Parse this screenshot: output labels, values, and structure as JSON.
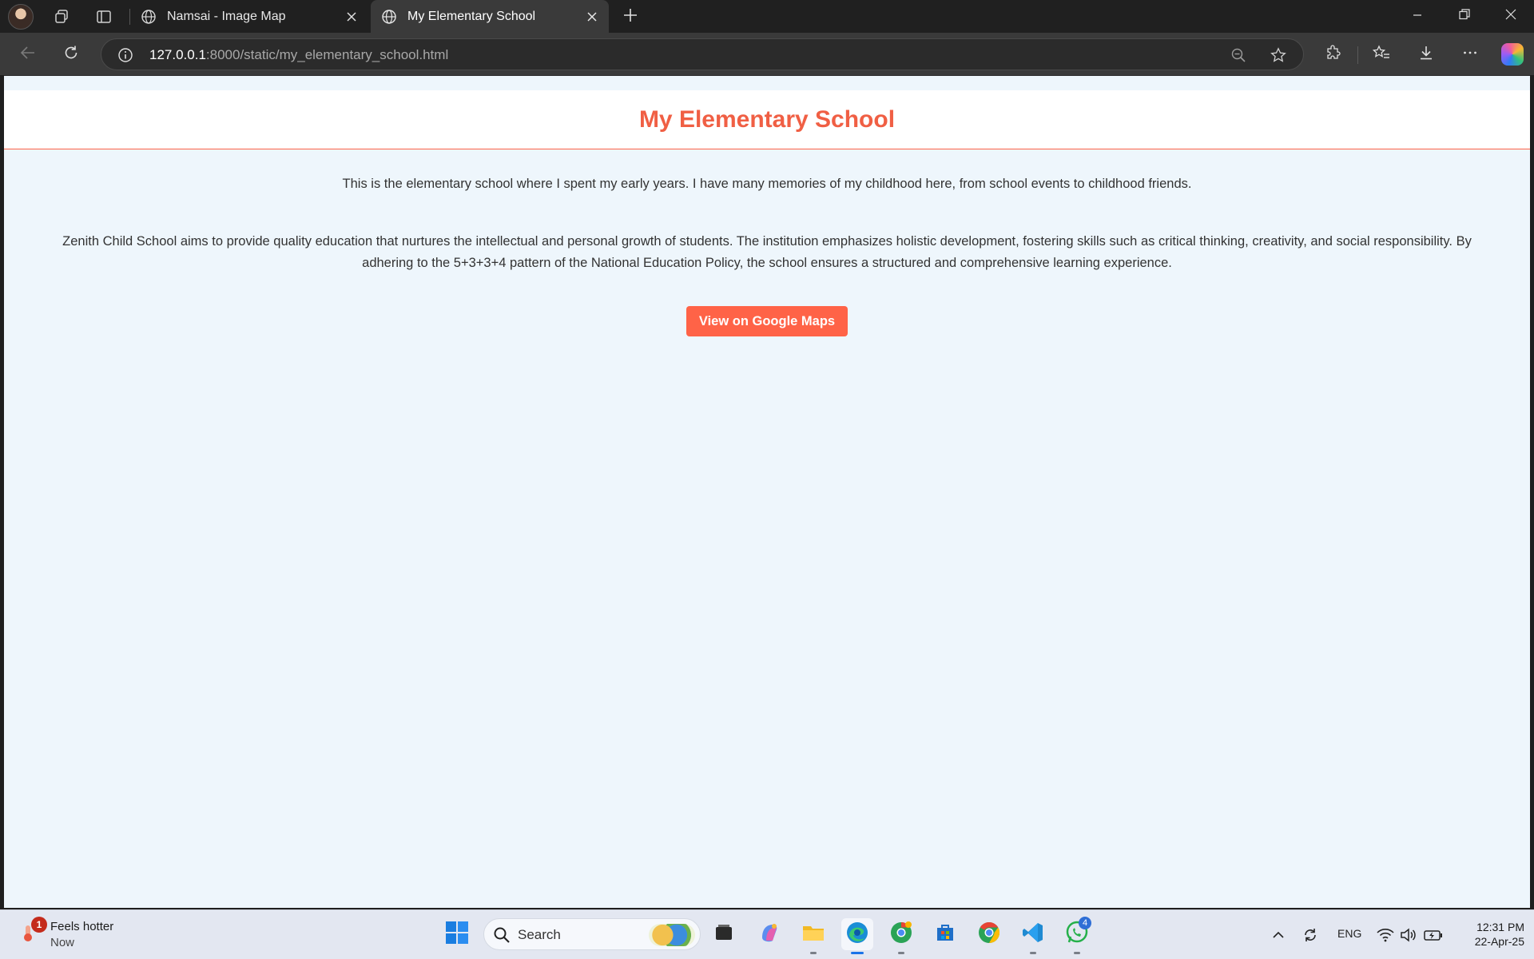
{
  "browser": {
    "tabs": [
      {
        "title": "Namsai - Image Map",
        "active": false
      },
      {
        "title": "My Elementary School",
        "active": true
      }
    ],
    "address": {
      "host": "127.0.0.1",
      "rest": ":8000/static/my_elementary_school.html"
    },
    "icons": [
      "profile-avatar",
      "workspaces-icon",
      "tab-actions-icon",
      "globe-icon",
      "close-icon",
      "plus-icon",
      "minimize-icon",
      "restore-icon",
      "close-window-icon",
      "back-icon",
      "refresh-icon",
      "info-icon",
      "zoom-out-icon",
      "favorite-star-icon",
      "extensions-icon",
      "favorites-icon",
      "downloads-icon",
      "more-icon",
      "copilot-icon"
    ]
  },
  "page": {
    "title": "My Elementary School",
    "paragraph1": "This is the elementary school where I spent my early years. I have many memories of my childhood here, from school events to childhood friends.",
    "paragraph2": "Zenith Child School aims to provide quality education that nurtures the intellectual and personal growth of students. The institution emphasizes holistic development, fostering skills such as critical thinking, creativity, and social responsibility. By adhering to the 5+3+3+4 pattern of the National Education Policy, the school ensures a structured and comprehensive learning experience.",
    "button_label": "View on Google Maps",
    "colors": {
      "accent": "#ff6347",
      "background": "#eef6fc",
      "header_bg": "#ffffff"
    }
  },
  "taskbar": {
    "weather": {
      "title": "Feels hotter",
      "subtitle": "Now",
      "badge": "1"
    },
    "search_label": "Search",
    "apps": [
      "windows-start",
      "search",
      "task-view",
      "copilot",
      "file-explorer",
      "edge",
      "chrome-canary",
      "microsoft-store",
      "chrome",
      "vscode",
      "whatsapp"
    ],
    "whatsapp_badge": "4",
    "language": "ENG",
    "time": "12:31 PM",
    "date": "22-Apr-25"
  }
}
